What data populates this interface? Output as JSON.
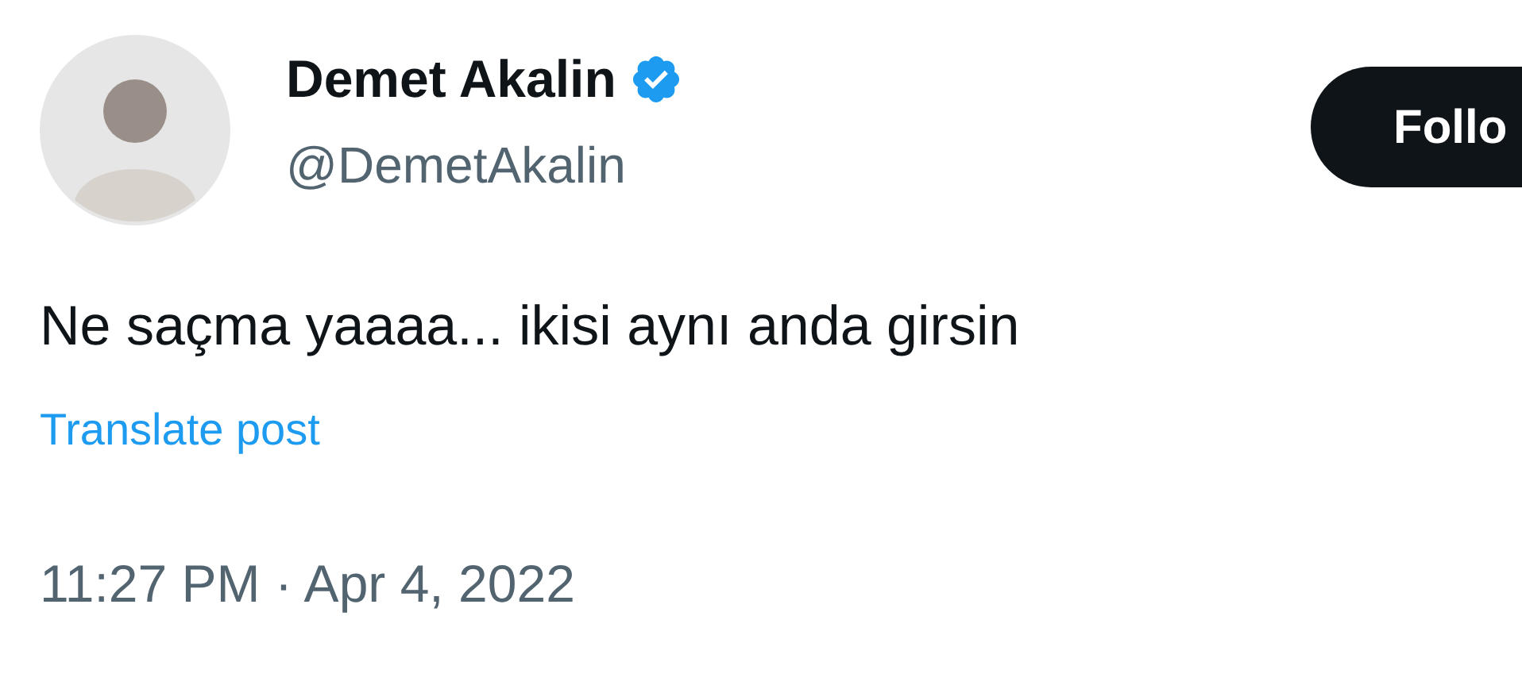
{
  "author": {
    "name": "Demet Akalin",
    "verified": true,
    "handle": "@DemetAkalin"
  },
  "follow_button": {
    "label": "Follo"
  },
  "post": {
    "text": "Ne saçma yaaaa... ikisi aynı anda girsin",
    "translate_link": "Translate post",
    "timestamp": "11:27 PM · Apr 4, 2022"
  }
}
